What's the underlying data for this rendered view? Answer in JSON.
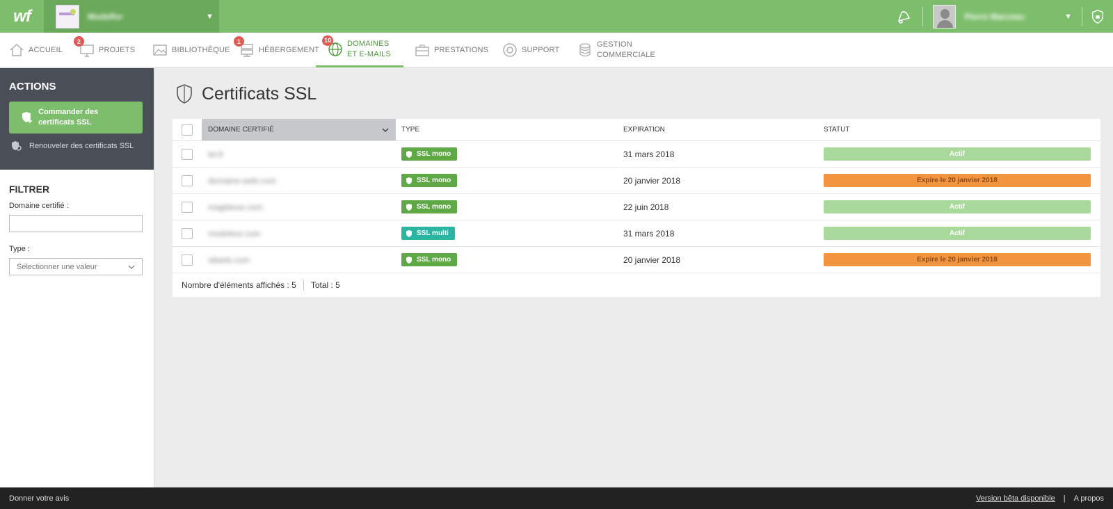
{
  "topbar": {
    "logo": "wf",
    "site_name": "Modelfor",
    "user_name": "Pierre Marceau"
  },
  "nav": {
    "items": [
      {
        "label": "ACCUEIL",
        "badge": ""
      },
      {
        "label": "PROJETS",
        "badge": "2"
      },
      {
        "label": "BIBLIOTHÈQUE",
        "badge": ""
      },
      {
        "label": "HÉBERGEMENT",
        "badge": "1"
      },
      {
        "label_1": "DOMAINES",
        "label_2": "ET E-MAILS",
        "badge": "10"
      },
      {
        "label": "PRESTATIONS",
        "badge": ""
      },
      {
        "label": "SUPPORT",
        "badge": ""
      },
      {
        "label_1": "GESTION",
        "label_2": "COMMERCIALE",
        "badge": ""
      }
    ],
    "active_index": 4
  },
  "sidebar": {
    "actions_title": "ACTIONS",
    "order_button_line1": "Commander des",
    "order_button_line2": "certificats SSL",
    "renew_label": "Renouveler des certificats SSL",
    "filter_title": "FILTRER",
    "domain_label": "Domaine certifié :",
    "domain_value": "",
    "type_label": "Type :",
    "type_placeholder": "Sélectionner une valeur"
  },
  "page": {
    "title": "Certificats SSL"
  },
  "table": {
    "headers": {
      "domain": "DOMAINE CERTIFIÉ",
      "type": "TYPE",
      "expiration": "EXPIRATION",
      "status": "STATUT"
    },
    "rows": [
      {
        "domain": "lel.fr",
        "type": "SSL mono",
        "type_kind": "mono",
        "expiration": "31 mars 2018",
        "status": "Actif",
        "status_kind": "active"
      },
      {
        "domain": "domaine-web.com",
        "type": "SSL mono",
        "type_kind": "mono",
        "expiration": "20 janvier 2018",
        "status": "Expire le 20 janvier 2018",
        "status_kind": "expire"
      },
      {
        "domain": "magbleue.com",
        "type": "SSL mono",
        "type_kind": "mono",
        "expiration": "22 juin 2018",
        "status": "Actif",
        "status_kind": "active"
      },
      {
        "domain": "modeleur.com",
        "type": "SSL multi",
        "type_kind": "multi",
        "expiration": "31 mars 2018",
        "status": "Actif",
        "status_kind": "active"
      },
      {
        "domain": "sitweb.com",
        "type": "SSL mono",
        "type_kind": "mono",
        "expiration": "20 janvier 2018",
        "status": "Expire le 20 janvier 2018",
        "status_kind": "expire"
      }
    ],
    "footer": {
      "displayed": "Nombre d'éléments affichés : 5",
      "total": "Total : 5"
    }
  },
  "footer": {
    "feedback": "Donner votre avis",
    "beta": "Version bêta disponible",
    "separator": "|",
    "about": "A propos"
  },
  "colors": {
    "brand_green": "#7dbe6c",
    "dark_green": "#6aa95a",
    "sidebar_dark": "#4a4e57",
    "status_active": "#a8d89a",
    "status_expire": "#f3943e",
    "tag_mono": "#5ea846",
    "tag_multi": "#2bb6a4"
  }
}
